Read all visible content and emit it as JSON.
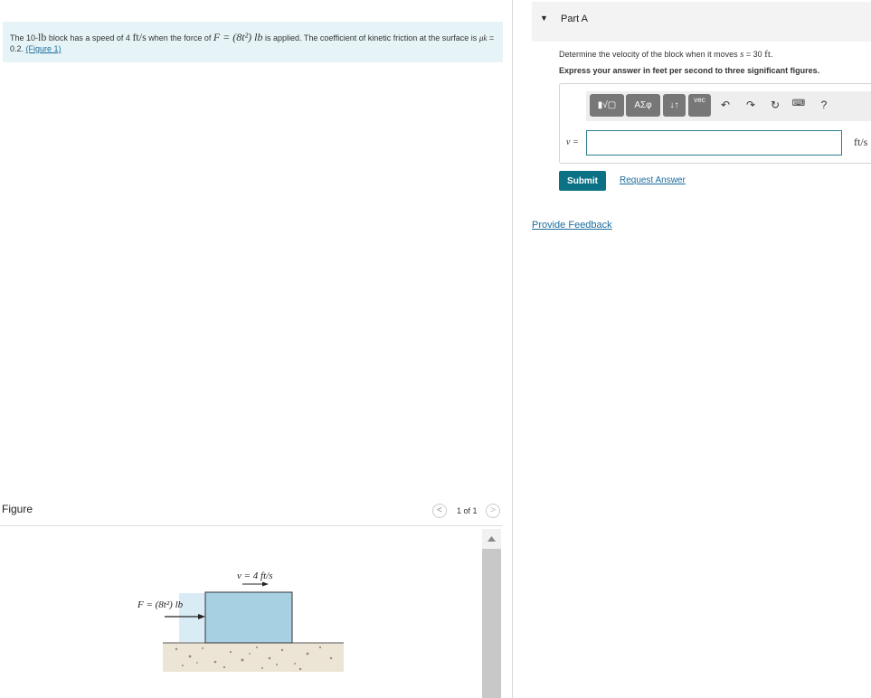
{
  "problem": {
    "text_1": "The 10-",
    "weight_unit": "lb",
    "text_2": " block has a speed of 4 ",
    "speed_unit": "ft/s",
    "text_3": " when the force of ",
    "force_expr": "F = (8t²) lb",
    "text_4": " is applied. The coefficient of kinetic friction at the surface is ",
    "mu": "μk",
    "text_5": " = 0.2. ",
    "figure_link": "(Figure 1)"
  },
  "figure": {
    "title": "Figure",
    "count": "1 of 1",
    "prev_icon": "chevron-left-icon",
    "next_icon": "chevron-right-icon",
    "velocity_label": "v = 4 ft/s",
    "force_label": "F = (8t²) lb",
    "block_color": "#a7d0e3",
    "ground_color": "#e9e2d4"
  },
  "partA": {
    "title": "Part A",
    "question_1": "Determine the velocity of the block when it moves ",
    "question_s": "s",
    "question_2": " = 30 ",
    "question_unit": "ft",
    "question_end": ".",
    "instruction": "Express your answer in feet per second to three significant figures.",
    "toolbar": {
      "templates": "▮√▢",
      "greek": "ΑΣφ",
      "arrows": "↓↑",
      "vec": "vec",
      "help": "?"
    },
    "variable": "v =",
    "answer_value": "",
    "units": "ft/s",
    "submit": "Submit",
    "request_answer": "Request Answer"
  },
  "feedback": "Provide Feedback",
  "colors": {
    "accent": "#0b7285",
    "link": "#1a6c9c",
    "problem_bg": "#e6f4f7"
  }
}
